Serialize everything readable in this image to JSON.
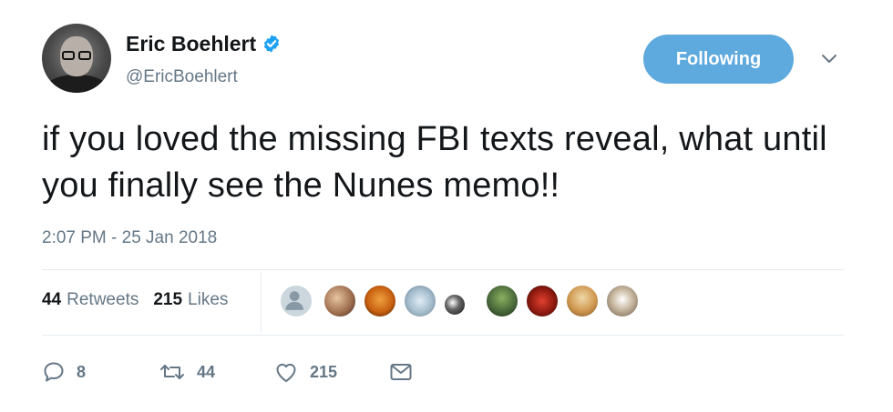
{
  "user": {
    "display_name": "Eric Boehlert",
    "handle": "@EricBoehlert",
    "verified_icon": "verified-badge-icon"
  },
  "header": {
    "follow_label": "Following",
    "more_icon": "chevron-down-icon"
  },
  "tweet": {
    "text": "if you loved the missing FBI texts reveal, what until you finally see the Nunes memo!!",
    "timestamp": "2:07 PM - 25 Jan 2018"
  },
  "stats": {
    "retweets_count": "44",
    "retweets_label": "Retweets",
    "likes_count": "215",
    "likes_label": "Likes"
  },
  "likers": [
    {
      "name": "liker-avatar-default"
    },
    {
      "name": "liker-avatar-2"
    },
    {
      "name": "liker-avatar-3"
    },
    {
      "name": "liker-avatar-4"
    },
    {
      "name": "liker-avatar-5"
    },
    {
      "name": "liker-avatar-6"
    },
    {
      "name": "liker-avatar-7"
    },
    {
      "name": "liker-avatar-8"
    },
    {
      "name": "liker-avatar-9"
    }
  ],
  "actions": {
    "reply_count": "8",
    "retweet_count": "44",
    "like_count": "215"
  },
  "colors": {
    "accent": "#5ea9dd",
    "verified": "#1da1f2",
    "muted": "#657786",
    "text": "#14171a",
    "divider": "#e6ecf0"
  }
}
